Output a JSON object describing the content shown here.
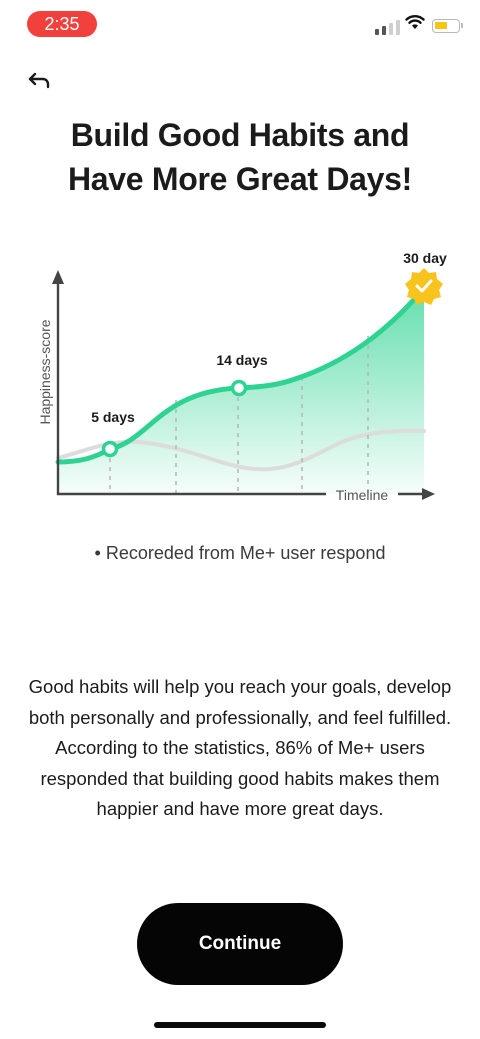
{
  "status_bar": {
    "time": "2:35"
  },
  "header": {
    "title_line1": "Build Good Habits and",
    "title_line2": "Have More Great Days!"
  },
  "chart": {
    "y_axis_label": "Happiness-score",
    "x_axis_label": "Timeline",
    "markers": [
      {
        "label": "5 days"
      },
      {
        "label": "14 days"
      },
      {
        "label": "30 day"
      }
    ]
  },
  "note": "• Recoreded from Me+ user respond",
  "description": "Good habits will help you reach your goals, develop both personally and professionally, and feel fulfilled. According to the statistics, 86% of Me+ users responded that building good habits makes them happier and have more great days.",
  "actions": {
    "continue_label": "Continue"
  },
  "colors": {
    "accent": "#2ed392",
    "badge": "#f7c31c",
    "alert": "#f2413c"
  }
}
